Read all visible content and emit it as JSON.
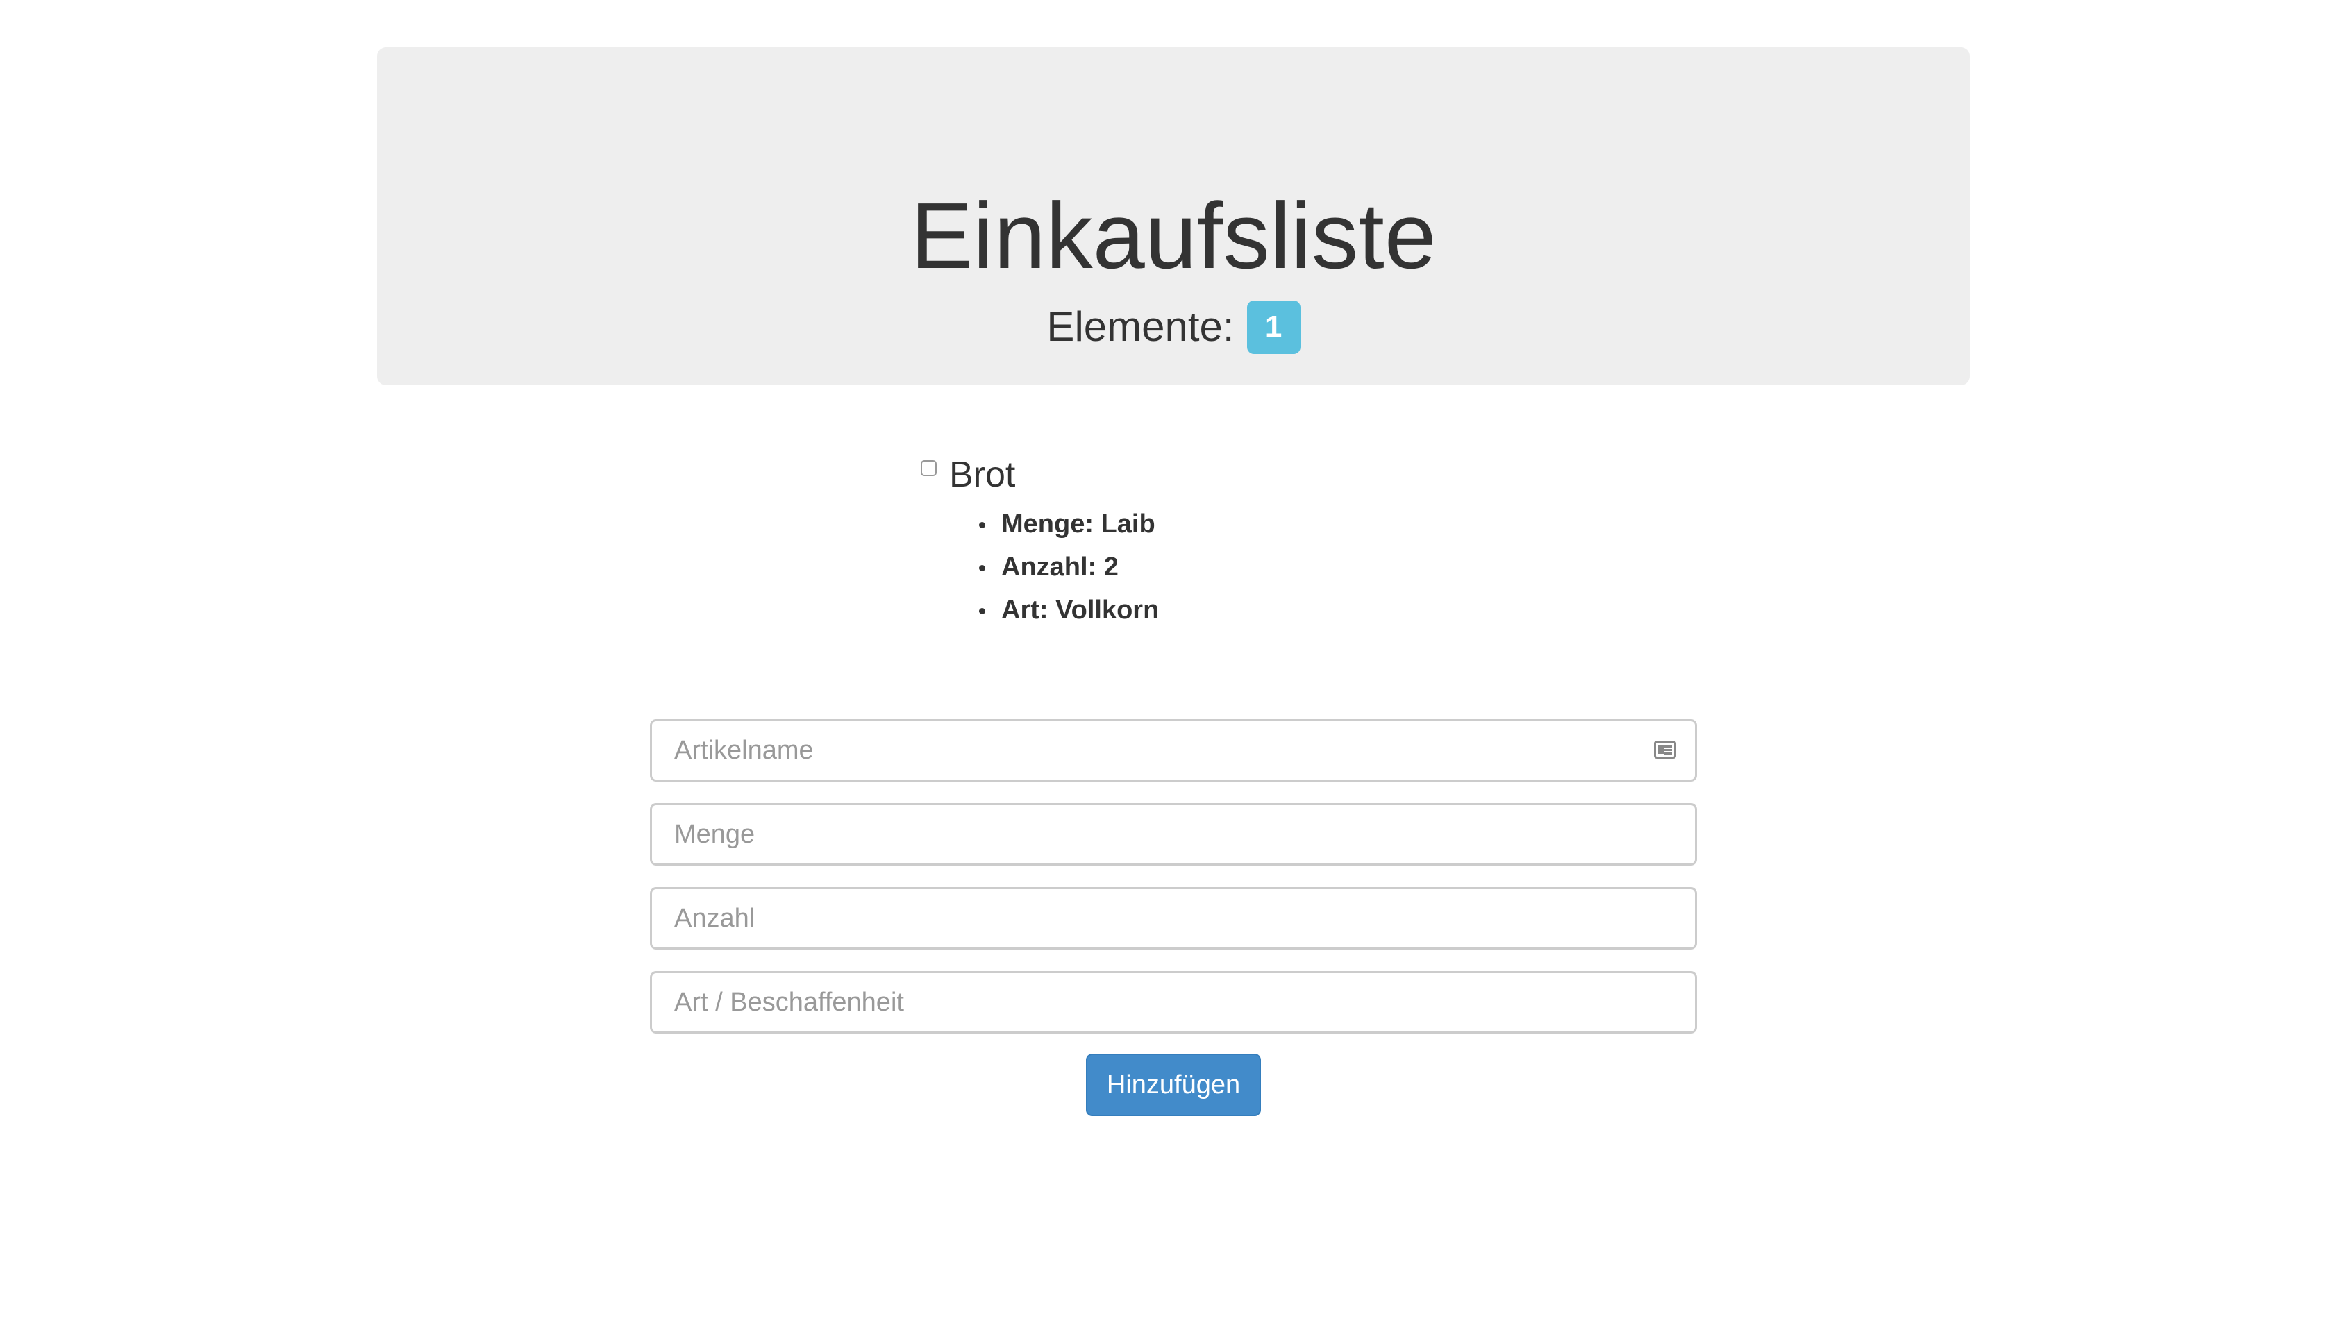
{
  "header": {
    "title": "Einkaufsliste",
    "count_label": "Elemente:",
    "count_value": "1"
  },
  "items": [
    {
      "name": "Brot",
      "checked": false,
      "details": [
        "Menge: Laib",
        "Anzahl: 2",
        "Art: Vollkorn"
      ]
    }
  ],
  "form": {
    "name_placeholder": "Artikelname",
    "menge_placeholder": "Menge",
    "anzahl_placeholder": "Anzahl",
    "art_placeholder": "Art / Beschaffenheit",
    "submit_label": "Hinzufügen",
    "name_icon": "contact-card-icon"
  },
  "colors": {
    "jumbotron_bg": "#eeeeee",
    "badge": "#5bc0de",
    "primary_button": "#428bca"
  }
}
